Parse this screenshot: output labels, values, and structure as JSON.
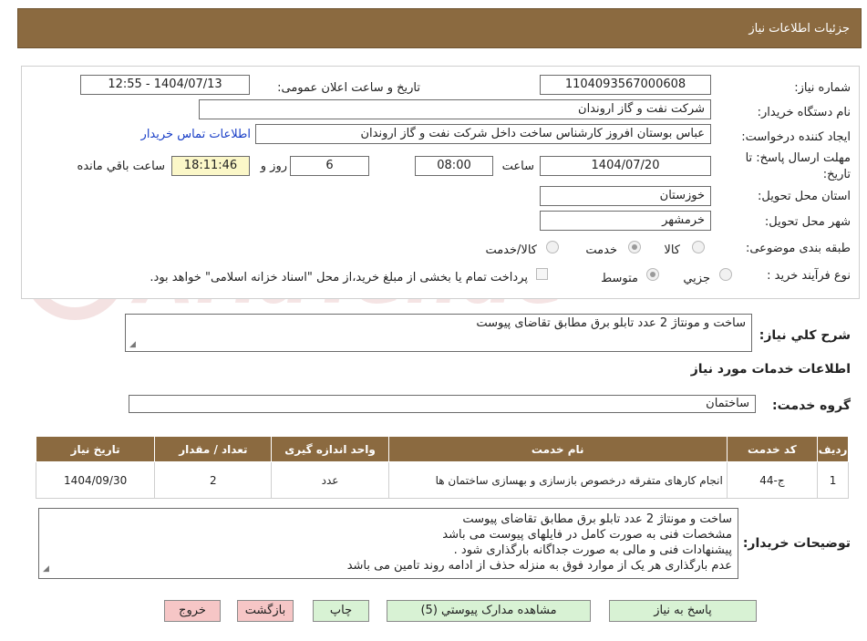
{
  "header": {
    "title": "جزئیات اطلاعات نیاز"
  },
  "labels": {
    "need_number": "شماره نیاز:",
    "announce_datetime": "تاریخ و ساعت اعلان عمومی:",
    "buyer_org": "نام دستگاه خریدار:",
    "requester": "ایجاد کننده درخواست:",
    "deadline_line1": "مهلت ارسال پاسخ: تا",
    "deadline_line2": "تاریخ:",
    "time": "ساعت",
    "days_and": "روز و",
    "remaining": "ساعت باقي مانده",
    "province": "استان محل تحویل:",
    "city": "شهر محل تحویل:",
    "category": "طبقه بندی موضوعی:",
    "process_type": "نوع فرآیند خرید :",
    "general_desc": "شرح كلي نياز:",
    "services_section": "اطلاعات خدمات مورد نیاز",
    "service_group": "گروه خدمت:",
    "buyer_notes": "توضیحات خریدار:"
  },
  "values": {
    "need_number": "1104093567000608",
    "announce_datetime": "1404/07/13 - 12:55",
    "buyer_org": "شرکت نفت و گاز اروندان",
    "requester": "عباس بوستان افروز کارشناس ساخت داخل شرکت نفت و گاز اروندان",
    "contact_link": "اطلاعات تماس خریدار",
    "deadline_date": "1404/07/20",
    "deadline_time": "08:00",
    "days": "6",
    "remaining_time": "18:11:46",
    "province": "خوزستان",
    "city": "خرمشهر",
    "general_desc": "ساخت و مونتاژ 2 عدد تابلو برق مطابق تقاضای پیوست",
    "service_group": "ساختمان"
  },
  "category_options": [
    {
      "label": "کالا",
      "selected": false
    },
    {
      "label": "خدمت",
      "selected": true
    },
    {
      "label": "کالا/خدمت",
      "selected": false
    }
  ],
  "process_options": [
    {
      "label": "جزيي",
      "selected": false
    },
    {
      "label": "متوسط",
      "selected": true
    }
  ],
  "treasury_note": "پرداخت تمام یا بخشی از مبلغ خرید،از محل \"اسناد خزانه اسلامی\" خواهد بود.",
  "table": {
    "headers": [
      "ردیف",
      "کد خدمت",
      "نام خدمت",
      "واحد اندازه گیری",
      "تعداد / مقدار",
      "تاریخ نیاز"
    ],
    "rows": [
      [
        "1",
        "ج-44",
        "انجام کارهای متفرقه درخصوص بازسازی و بهسازی ساختمان ها",
        "عدد",
        "2",
        "1404/09/30"
      ]
    ]
  },
  "buyer_notes_lines": [
    "ساخت و مونتاژ 2 عدد تابلو برق مطابق تقاضای پیوست",
    "مشخصات فنی به صورت کامل در فایلهای پیوست می باشد",
    "پیشنهادات فنی و مالی به صورت جداگانه بارگذاری شود .",
    "عدم بارگذاری هر یک از موارد فوق به منزله حذف از ادامه روند تامین  می باشد"
  ],
  "buttons": {
    "reply": "پاسخ به نیاز",
    "attachments": "مشاهده مدارک پیوستي (5)",
    "print": "چاپ",
    "back": "بازگشت",
    "exit": "خروج"
  },
  "watermark": {
    "text": "AriaTender.neT"
  },
  "colors": {
    "header": "#8b6a40",
    "button_green": "#d8f2d4",
    "button_pink": "#f6c6c6",
    "link": "#1a3fc7",
    "highlight": "#fbf7c8"
  }
}
